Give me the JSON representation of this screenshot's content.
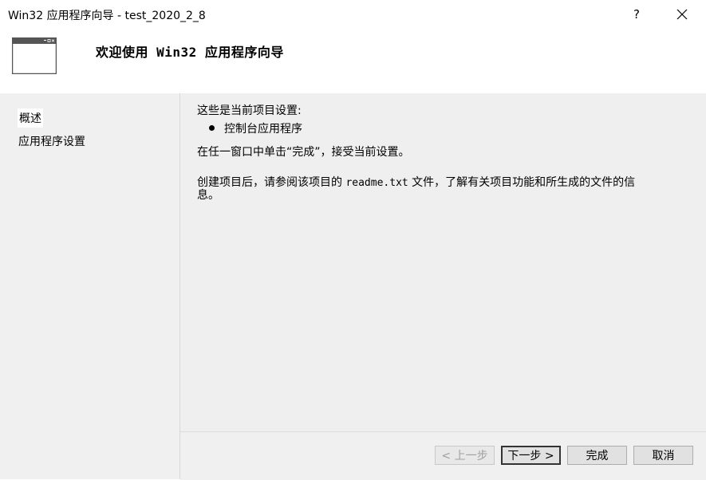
{
  "window": {
    "title": "Win32 应用程序向导 - test_2020_2_8",
    "help_label": "?"
  },
  "header": {
    "title": "欢迎使用 Win32 应用程序向导"
  },
  "sidebar": {
    "items": [
      {
        "label": "概述",
        "selected": true
      },
      {
        "label": "应用程序设置",
        "selected": false
      }
    ]
  },
  "main": {
    "settings_intro": "这些是当前项目设置:",
    "settings_bullet": "控制台应用程序",
    "finish_hint": "在任一窗口中单击“完成”，接受当前设置。",
    "readme_line1_part1": "创建项目后，请参阅该项目的 ",
    "readme_file": "readme.txt",
    "readme_line1_part2": " 文件，了解有关项目功能和所生成的文件的信",
    "readme_line2": "息。"
  },
  "footer": {
    "prev_label": "< 上一步",
    "next_label": "下一步 >",
    "finish_label": "完成",
    "cancel_label": "取消"
  }
}
